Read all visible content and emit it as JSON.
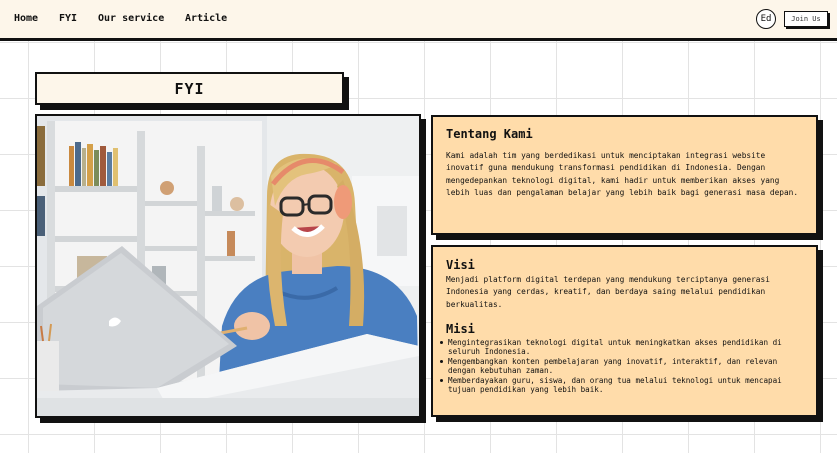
{
  "nav": {
    "links": [
      "Home",
      "FYI",
      "Our service",
      "Article"
    ],
    "avatar_initials": "Ed",
    "join_label": "Join Us"
  },
  "page": {
    "title": "FYI"
  },
  "about": {
    "title": "Tentang Kami",
    "text": "Kami adalah tim yang berdedikasi untuk menciptakan integrasi website inovatif guna mendukung transformasi pendidikan di Indonesia. Dengan mengedepankan teknologi digital, kami hadir untuk memberikan akses yang lebih luas dan pengalaman belajar yang lebih baik bagi generasi masa depan."
  },
  "vision": {
    "title": "Visi",
    "text": "Menjadi platform digital terdepan yang mendukung terciptanya generasi Indonesia yang cerdas, kreatif, dan berdaya saing melalui pendidikan berkualitas."
  },
  "mission": {
    "title": "Misi",
    "items": [
      "Mengintegrasikan teknologi digital untuk meningkatkan akses pendidikan di seluruh Indonesia.",
      "Mengembangkan konten pembelajaran yang inovatif, interaktif, dan relevan dengan kebutuhan zaman.",
      "Memberdayakan guru, siswa, dan orang tua melalui teknologi untuk mencapai tujuan pendidikan yang lebih baik."
    ]
  },
  "colors": {
    "nav_bg": "#fdf6ea",
    "card_bg": "#ffdcaa",
    "border": "#111111"
  }
}
